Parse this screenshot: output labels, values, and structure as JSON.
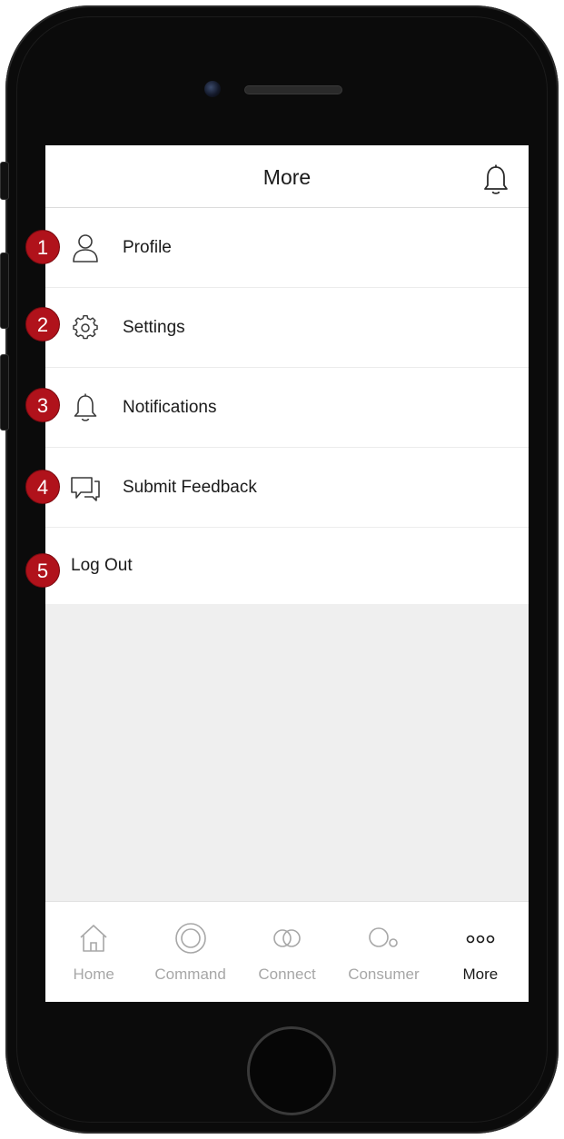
{
  "header": {
    "title": "More",
    "notification_icon": "bell-icon"
  },
  "menu": {
    "items": [
      {
        "badge": "1",
        "label": "Profile",
        "icon": "user-icon"
      },
      {
        "badge": "2",
        "label": "Settings",
        "icon": "gear-icon"
      },
      {
        "badge": "3",
        "label": "Notifications",
        "icon": "bell-icon"
      },
      {
        "badge": "4",
        "label": "Submit Feedback",
        "icon": "chat-bubbles-icon"
      },
      {
        "badge": "5",
        "label": "Log Out"
      }
    ]
  },
  "tabbar": {
    "tabs": [
      {
        "label": "Home",
        "icon": "home-icon",
        "active": false
      },
      {
        "label": "Command",
        "icon": "target-icon",
        "active": false
      },
      {
        "label": "Connect",
        "icon": "overlapping-circles-icon",
        "active": false
      },
      {
        "label": "Consumer",
        "icon": "circles-icon",
        "active": false
      },
      {
        "label": "More",
        "icon": "dots-icon",
        "active": true
      }
    ]
  },
  "colors": {
    "badge": "#b0121b",
    "tab_inactive": "#a7a7a7",
    "tab_active": "#1a1a1a",
    "content_background": "#efefef"
  }
}
